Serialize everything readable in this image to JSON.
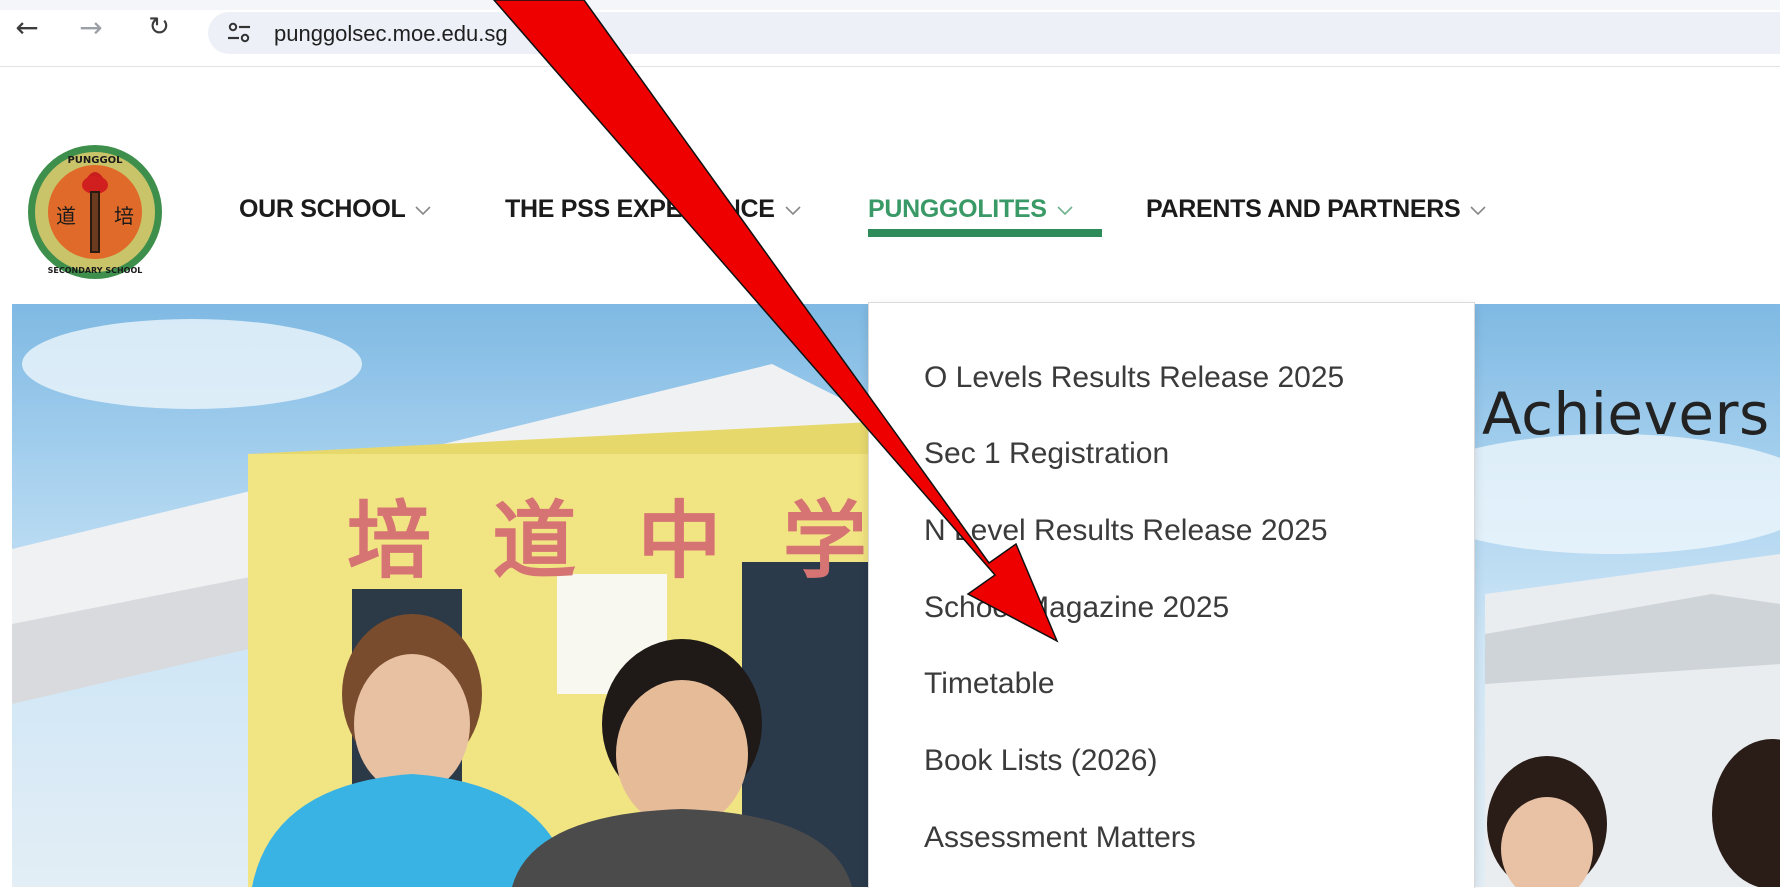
{
  "browser": {
    "back_icon": "back-arrow-icon",
    "forward_icon": "forward-arrow-icon",
    "reload_icon": "reload-icon",
    "site_info_icon": "tune-icon",
    "url": "punggolsec.moe.edu.sg"
  },
  "header": {
    "logo_icon": "school-crest-logo",
    "logo_text": {
      "top_arc": "PUNGGOL",
      "bottom_arc": "SECONDARY SCHOOL",
      "left_char": "道",
      "right_char": "培"
    },
    "nav": [
      {
        "label": "OUR SCHOOL",
        "active": false
      },
      {
        "label": "THE PSS EXPERIENCE",
        "active": false
      },
      {
        "label": "PUNGGOLITES",
        "active": true
      },
      {
        "label": "PARENTS AND PARTNERS",
        "active": false
      }
    ]
  },
  "dropdown": {
    "items": [
      "O Levels Results Release 2025",
      "Sec 1 Registration",
      "N Level Results Release 2025",
      "School Magazine 2025",
      "Timetable",
      "Book Lists (2026)",
      "Assessment Matters"
    ]
  },
  "hero": {
    "title": "Achievers",
    "building_sign": "培 道 中 学"
  },
  "annotation": {
    "arrow_color": "#ee0000"
  },
  "colors": {
    "active_nav": "#3a9a67",
    "underline": "#2e8b5a"
  }
}
